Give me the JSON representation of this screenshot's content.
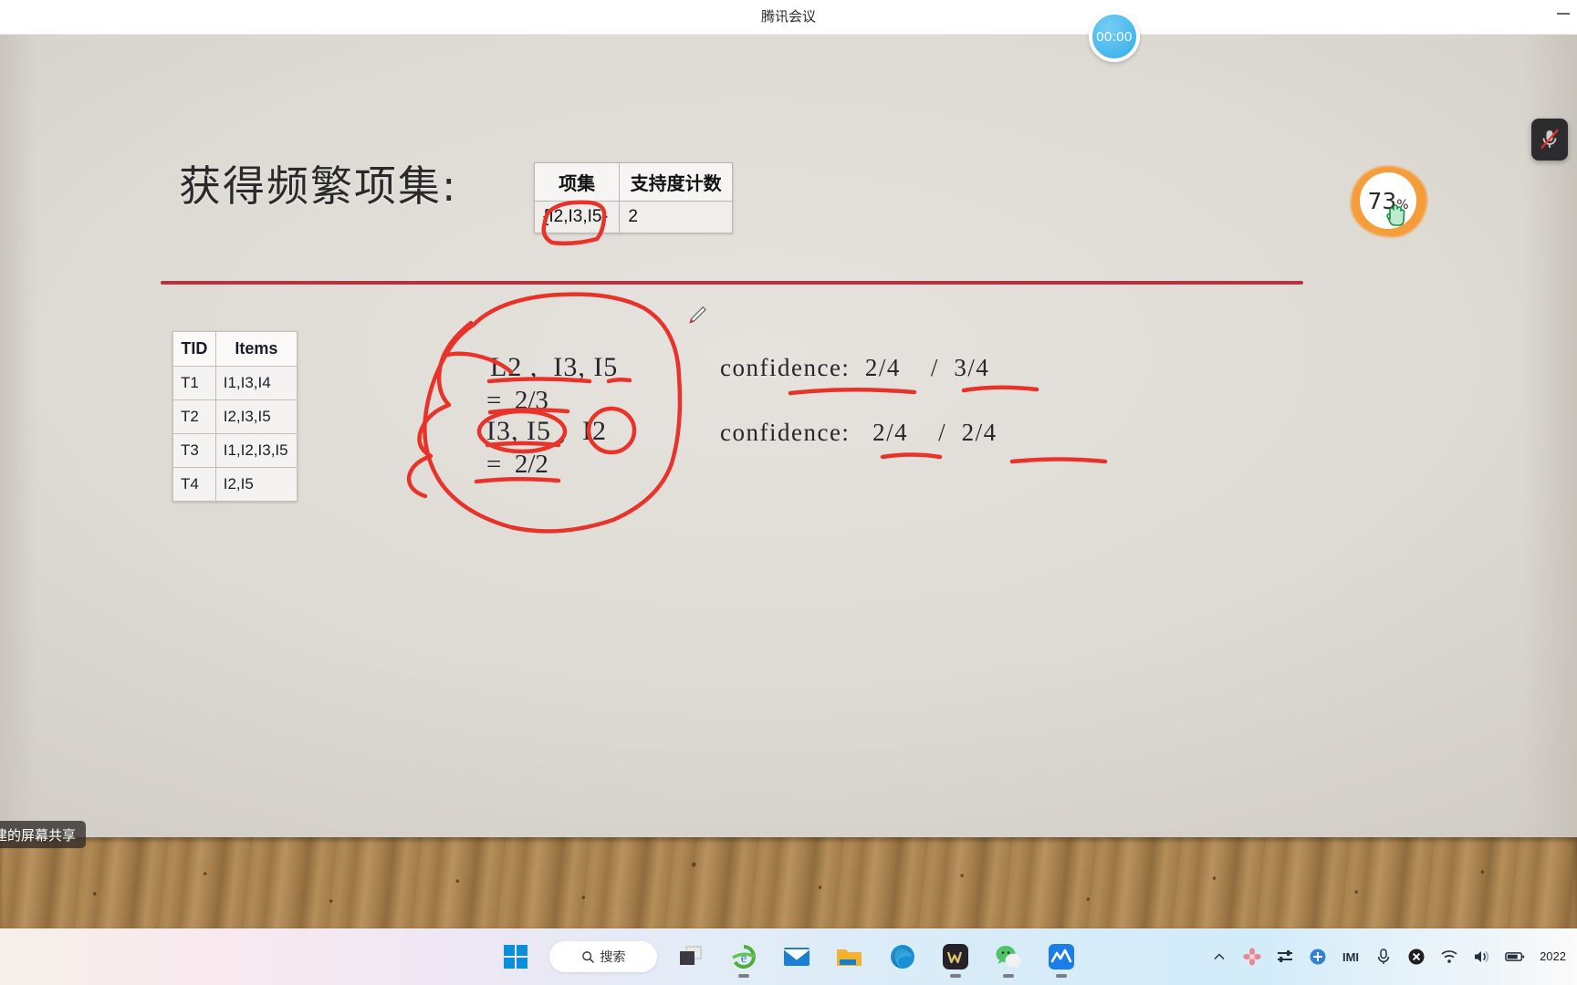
{
  "window": {
    "title": "腾讯会议",
    "minimize_label": "—"
  },
  "meeting": {
    "timer": "00:00",
    "zoom_percent": "73",
    "zoom_percent_suffix": "%",
    "mic_status": "muted",
    "share_tooltip": "建的屏幕共享"
  },
  "slide": {
    "heading": "获得频繁项集:",
    "support_table": {
      "headers": [
        "项集",
        "支持度计数"
      ],
      "rows": [
        [
          "{I2,I3,I5}",
          "2"
        ]
      ]
    },
    "transaction_table": {
      "headers": [
        "TID",
        "Items"
      ],
      "rows": [
        [
          "T1",
          "I1,I3,I4"
        ],
        [
          "T2",
          "I2,I3,I5"
        ],
        [
          "T3",
          "I1,I2,I3,I5"
        ],
        [
          "T4",
          "I2,I5"
        ]
      ]
    },
    "annotations": {
      "line1": "L2 ,  I3, I5",
      "line2": "=  2/3",
      "line3": "I3, I5 ,  I2",
      "line4": "=  2/2",
      "confidence1": "confidence:  2/4    /  3/4",
      "confidence2": "confidence:   2/4    /  2/4"
    },
    "ink_color": "#e8332a",
    "divider_color": "#b3333e"
  },
  "taskbar": {
    "start_label": "start-windows",
    "search_placeholder": "搜索",
    "items": [
      {
        "name": "start-button",
        "label": "开始"
      },
      {
        "name": "search-box",
        "label": "搜索"
      },
      {
        "name": "task-view-button",
        "label": "任务视图"
      },
      {
        "name": "internet-explorer-icon",
        "label": "Internet Explorer"
      },
      {
        "name": "mail-icon",
        "label": "邮件"
      },
      {
        "name": "file-explorer-icon",
        "label": "文件资源管理器"
      },
      {
        "name": "microsoft-edge-icon",
        "label": "Microsoft Edge"
      },
      {
        "name": "wps-office-icon",
        "label": "WPS Office"
      },
      {
        "name": "wechat-icon",
        "label": "微信"
      },
      {
        "name": "tencent-meeting-icon",
        "label": "腾讯会议"
      }
    ],
    "tray": [
      {
        "name": "show-hidden-icons-chevron",
        "label": "^"
      },
      {
        "name": "flower-app-icon",
        "label": "应用"
      },
      {
        "name": "sound-mixer-icon",
        "label": "音量合成器"
      },
      {
        "name": "update-icon",
        "label": "更新"
      },
      {
        "name": "imi-input-icon",
        "label": "IMI"
      },
      {
        "name": "microphone-icon",
        "label": "麦克风"
      },
      {
        "name": "close-status-icon",
        "label": "关闭"
      },
      {
        "name": "wifi-icon",
        "label": "网络"
      },
      {
        "name": "volume-icon",
        "label": "音量"
      },
      {
        "name": "battery-icon",
        "label": "电池"
      }
    ],
    "clock": "2022"
  }
}
